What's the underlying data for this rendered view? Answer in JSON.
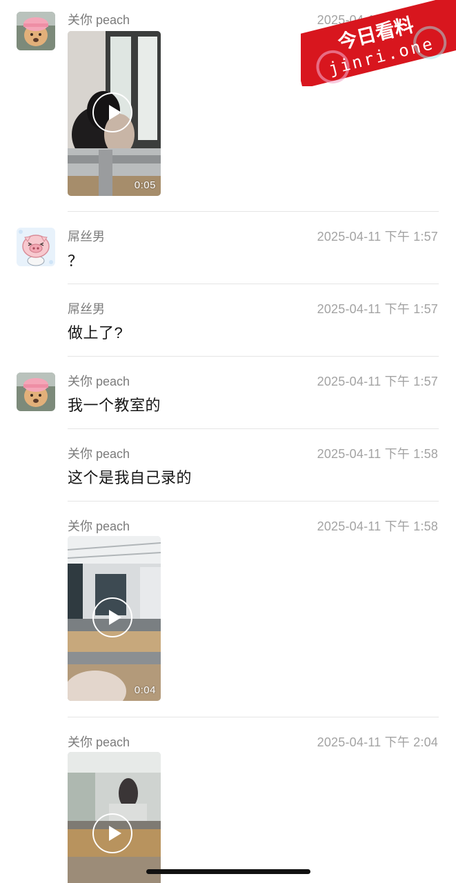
{
  "messages": [
    {
      "sender": "关你 peach",
      "time": "2025-04-11 下午 1:57",
      "video_duration": "0:05"
    },
    {
      "sender": "屌丝男",
      "time": "2025-04-11 下午 1:57",
      "text": "？"
    },
    {
      "sender": "屌丝男",
      "time": "2025-04-11 下午 1:57",
      "text": "做上了?"
    },
    {
      "sender": "关你 peach",
      "time": "2025-04-11 下午 1:57",
      "text": "我一个教室的"
    },
    {
      "sender": "关你 peach",
      "time": "2025-04-11 下午 1:58",
      "text": "这个是我自己录的"
    },
    {
      "sender": "关你 peach",
      "time": "2025-04-11 下午 1:58",
      "video_duration": "0:04"
    },
    {
      "sender": "关你 peach",
      "time": "2025-04-11 下午 2:04"
    }
  ],
  "watermark": {
    "title": "今日看料",
    "site": "jinri.one",
    "color": "#d8161e"
  },
  "colors": {
    "sender": "#7b7b7b",
    "time": "#a3a3a3",
    "divider": "#e5e5e5"
  }
}
